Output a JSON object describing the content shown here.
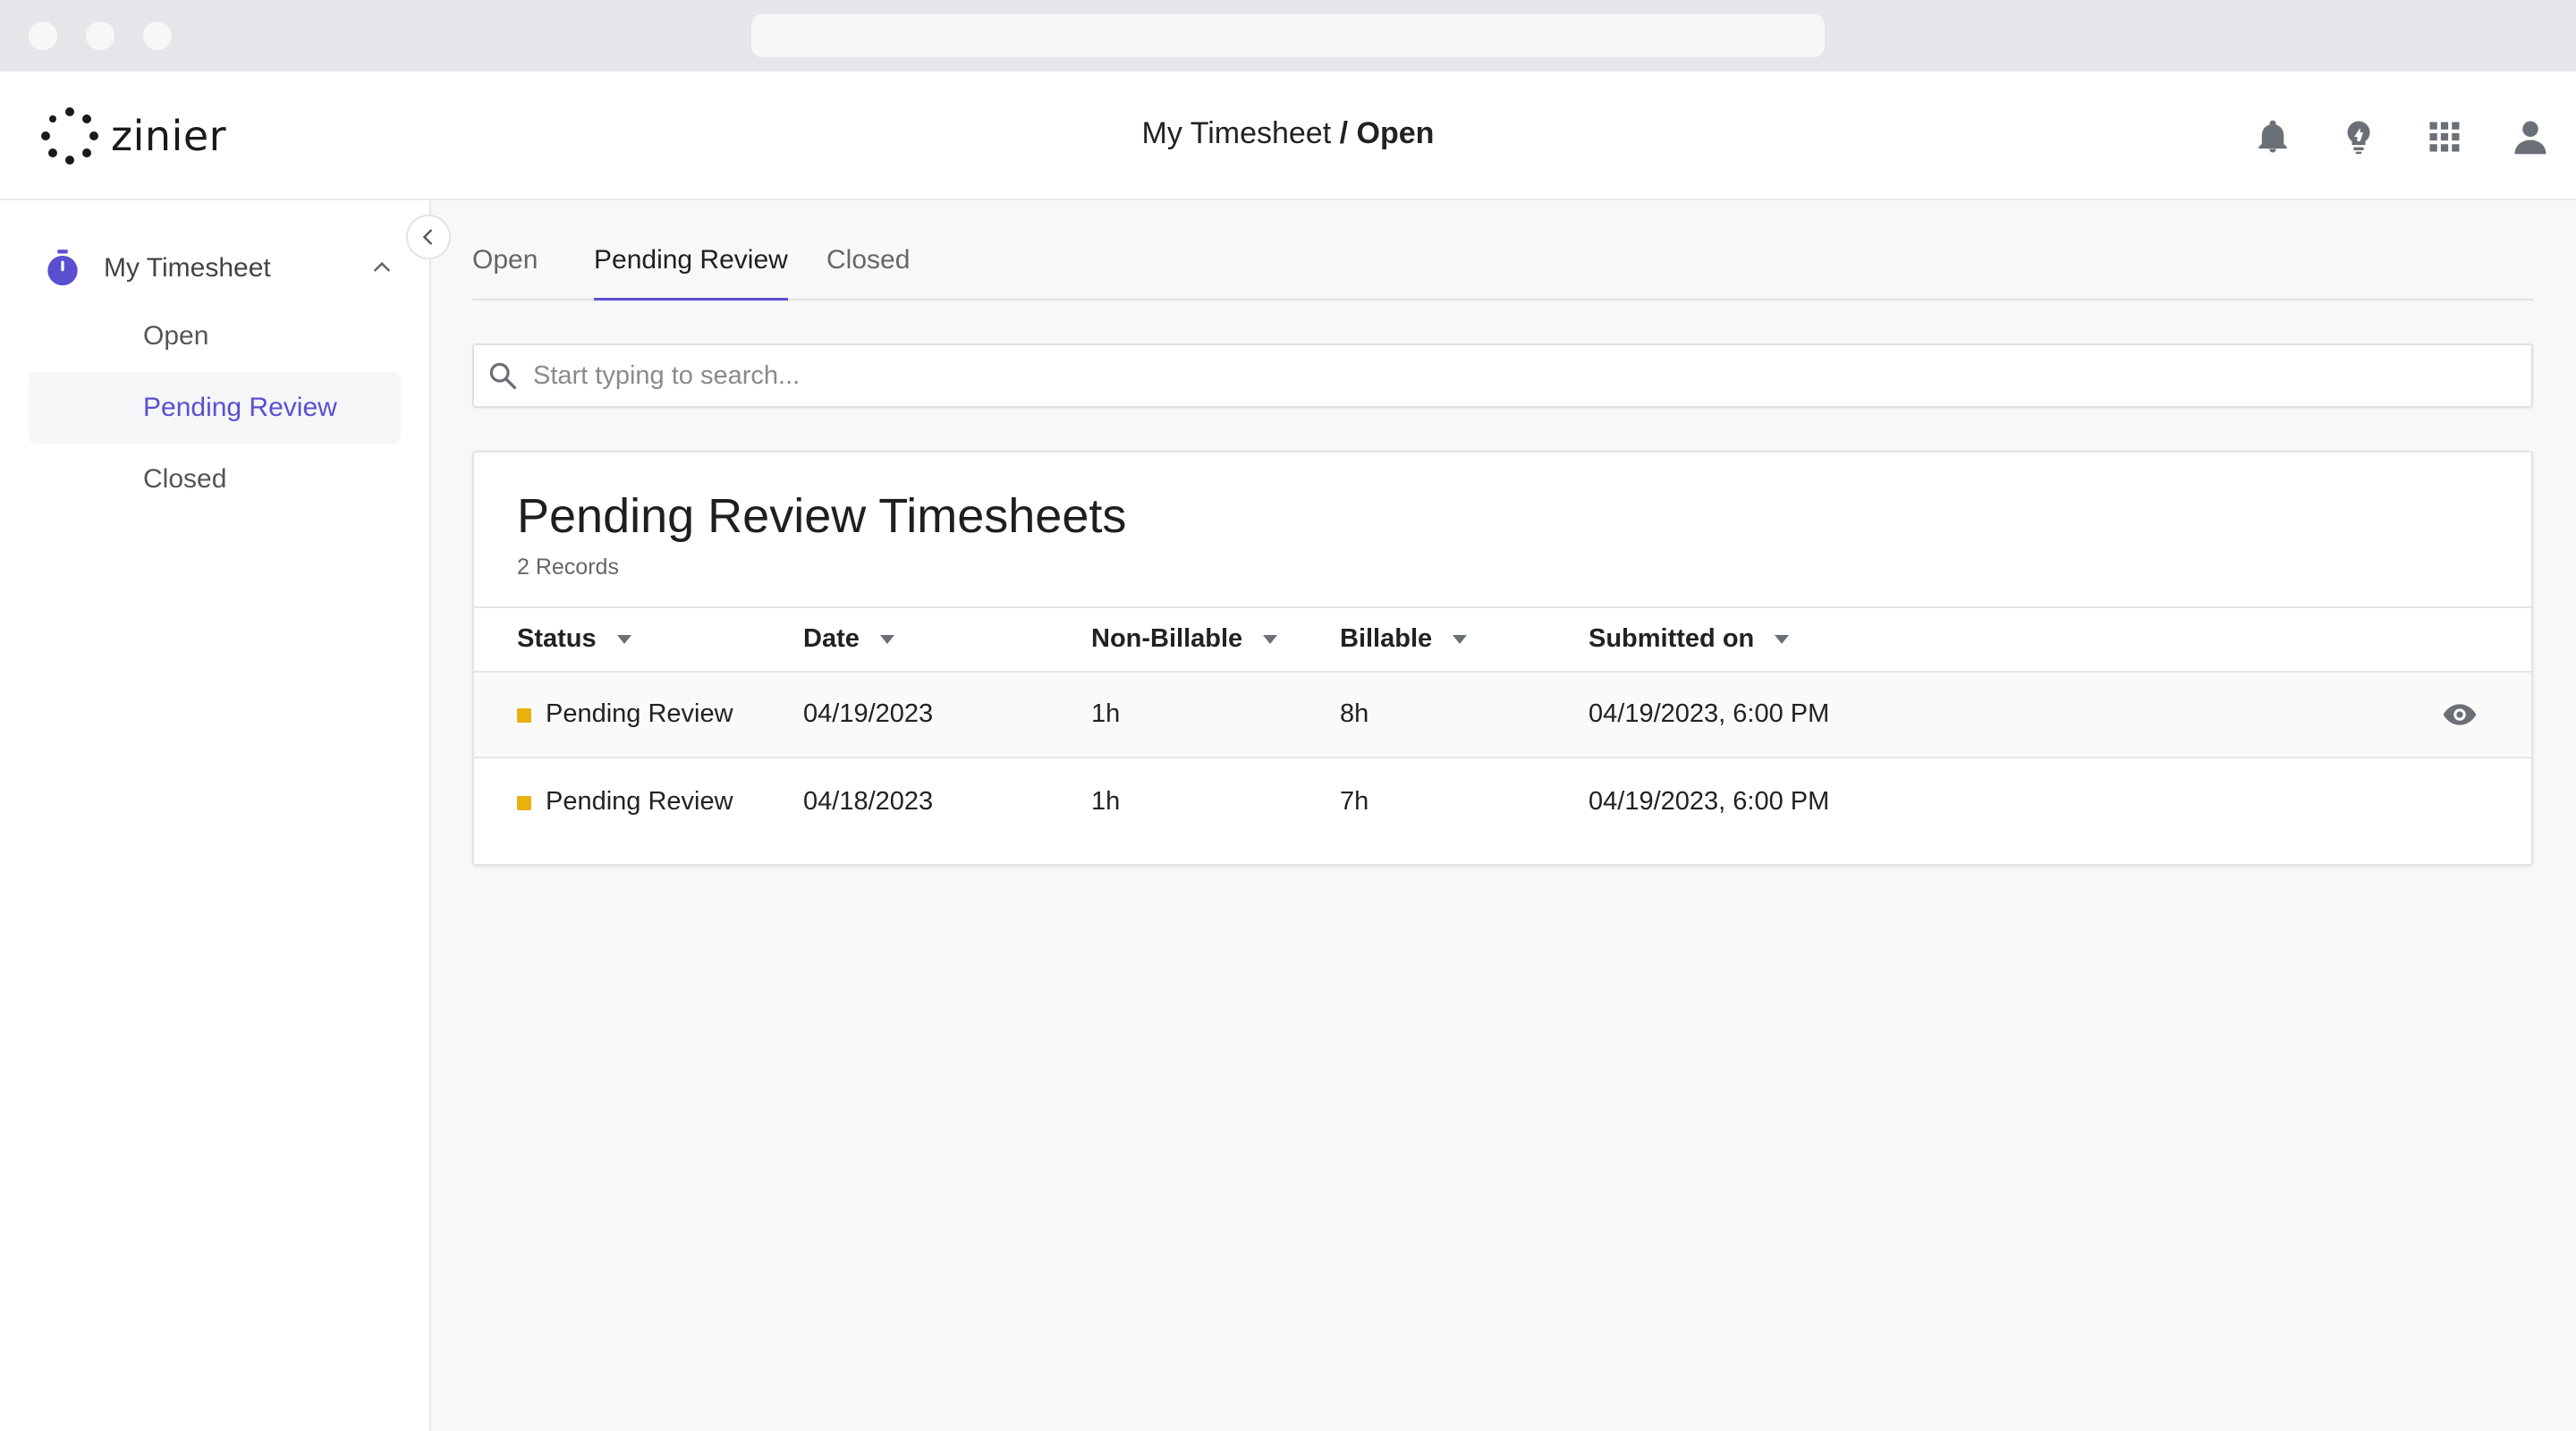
{
  "brand": {
    "name": "zinier"
  },
  "header": {
    "title_section": "My Timesheet",
    "title_separator": "/",
    "title_current": "Open"
  },
  "header_icons": [
    "bell-icon",
    "lightbulb-icon",
    "apps-grid-icon",
    "user-icon"
  ],
  "sidebar": {
    "section_label": "My Timesheet",
    "items": [
      {
        "label": "Open",
        "active": false
      },
      {
        "label": "Pending Review",
        "active": true
      },
      {
        "label": "Closed",
        "active": false
      }
    ]
  },
  "tabs": [
    {
      "label": "Open",
      "active": false
    },
    {
      "label": "Pending Review",
      "active": true
    },
    {
      "label": "Closed",
      "active": false
    }
  ],
  "search": {
    "placeholder": "Start typing to search..."
  },
  "table": {
    "title": "Pending Review Timesheets",
    "record_count": "2 Records",
    "columns": [
      "Status",
      "Date",
      "Non-Billable",
      "Billable",
      "Submitted on"
    ],
    "rows": [
      {
        "status": "Pending Review",
        "date": "04/19/2023",
        "non_billable": "1h",
        "billable": "8h",
        "submitted_on": "04/19/2023, 6:00 PM"
      },
      {
        "status": "Pending Review",
        "date": "04/18/2023",
        "non_billable": "1h",
        "billable": "7h",
        "submitted_on": "04/19/2023, 6:00 PM"
      }
    ]
  },
  "colors": {
    "accent": "#5b4fd1",
    "status_pending": "#e8b10c",
    "icon_gray": "#6b6f76"
  }
}
